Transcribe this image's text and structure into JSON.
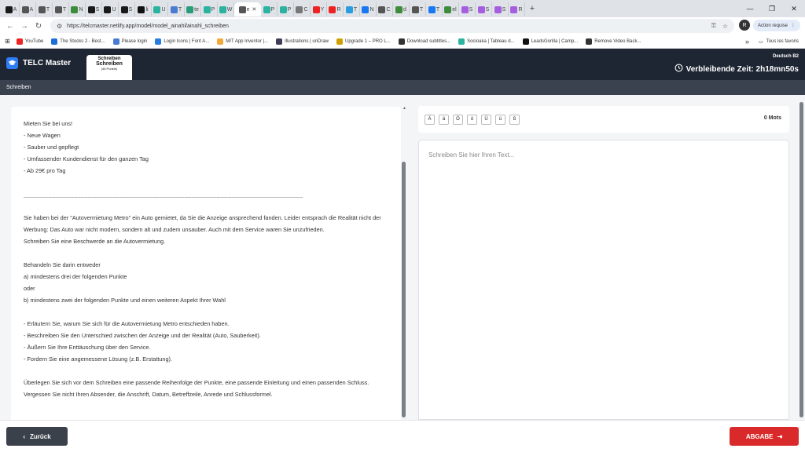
{
  "browser": {
    "tabs": [
      {
        "label": "A",
        "color": "#1a1a1a"
      },
      {
        "label": "A",
        "color": "#555"
      },
      {
        "label": "T",
        "color": "#555"
      },
      {
        "label": "T",
        "color": "#555"
      },
      {
        "label": "N",
        "color": "#3c8c3c"
      },
      {
        "label": "S",
        "color": "#1a1a1a"
      },
      {
        "label": "U",
        "color": "#1a1a1a"
      },
      {
        "label": "S",
        "color": "#1a1a1a"
      },
      {
        "label": "li",
        "color": "#111"
      },
      {
        "label": "U",
        "color": "#2bb3a0"
      },
      {
        "label": "T",
        "color": "#4a7bd0"
      },
      {
        "label": "te",
        "color": "#2b9c7a"
      },
      {
        "label": "P",
        "color": "#2bb3a0"
      },
      {
        "label": "W",
        "color": "#2bb3a0"
      }
    ],
    "active_tab": {
      "label": "e",
      "color": "#555"
    },
    "tabs_after": [
      {
        "label": "P",
        "color": "#2bb3a0"
      },
      {
        "label": "P",
        "color": "#2bb3a0"
      },
      {
        "label": "C",
        "color": "#777"
      },
      {
        "label": "Y",
        "color": "#e22"
      },
      {
        "label": "R",
        "color": "#e22"
      },
      {
        "label": "T",
        "color": "#2a9de0"
      },
      {
        "label": "N",
        "color": "#1877f2"
      },
      {
        "label": "C",
        "color": "#555"
      },
      {
        "label": "d",
        "color": "#3c8c3c"
      },
      {
        "label": "T",
        "color": "#555"
      },
      {
        "label": "T",
        "color": "#1877f2"
      },
      {
        "label": "el",
        "color": "#3c8c3c"
      },
      {
        "label": "S",
        "color": "#a55ee0"
      },
      {
        "label": "S",
        "color": "#a55ee0"
      },
      {
        "label": "S",
        "color": "#a55ee0"
      },
      {
        "label": "R",
        "color": "#a55ee0"
      }
    ],
    "new_tab_label": "+",
    "url": "https://telcmaster.netlify.app/model/model_ainahl/ainahl_schreiben",
    "profile_initial": "R",
    "action_label": "Action requise",
    "bookmarks": [
      {
        "label": "YouTube",
        "color": "#e22"
      },
      {
        "label": "The Stocks 2 - Best...",
        "color": "#1d6fd8"
      },
      {
        "label": "Please login",
        "color": "#4a7bd0"
      },
      {
        "label": "Login Icons | Font A...",
        "color": "#2a7de0"
      },
      {
        "label": "MIT App Inventor |...",
        "color": "#f2a93b"
      },
      {
        "label": "Illustrations | unDraw",
        "color": "#3f3d56"
      },
      {
        "label": "Upgrade 1 – PRO L...",
        "color": "#d1a000"
      },
      {
        "label": "Download subtitles...",
        "color": "#333"
      },
      {
        "label": "Socioaka | Tableau d...",
        "color": "#2bb3a0"
      },
      {
        "label": "LeadsGorilla | Camp...",
        "color": "#111"
      },
      {
        "label": "Remove Video Back...",
        "color": "#333"
      }
    ],
    "bookmarks_overflow": "»",
    "all_bookmarks": "Tous les favoris"
  },
  "header": {
    "brand": "TELC Master",
    "part_tab": {
      "line1": "Schreiben",
      "line2": "Schreiben",
      "line3": "(45 Punkte)"
    },
    "exam_level": "Deutsch B2",
    "timer_label": "Verbleibende Zeit: 2h18mn50s"
  },
  "section_title": "Schreiben",
  "task": {
    "ad_lines": [
      "Mieten Sie bei uns!",
      "- Neue Wagen",
      "- Sauber und gepflegt",
      "- Umfassender Kundendienst für den ganzen Tag",
      "- Ab 29€ pro Tag"
    ],
    "separator": "______________________________________________________________________________",
    "situation_lines": [
      "Sie haben bei der \"Autovermietung Metro\" ein Auto gemietet, da Sie die Anzeige ansprechend fanden. Leider entsprach die Realität nicht der Werbung: Das Auto war nicht modern, sondern alt und zudem unsauber. Auch mit dem Service waren Sie unzufrieden.",
      "Schreiben Sie eine Beschwerde an die Autovermietung."
    ],
    "instruction_lines": [
      "Behandeln Sie darin entweder",
      "a) mindestens drei der folgenden Punkte",
      "oder",
      "b) mindestens zwei der folgenden Punkte und einen weiteren Aspekt Ihrer Wahl"
    ],
    "points": [
      "- Erläutern Sie, warum Sie sich für die Autovermietung Metro entschieden haben.",
      "- Beschreiben Sie den Unterschied zwischen der Anzeige und der Realität (Auto, Sauberkeit).",
      "- Äußern Sie Ihre Enttäuschung über den Service.",
      "- Fordern Sie eine angemessene Lösung (z.B. Erstattung)."
    ],
    "closing": "Überlegen Sie sich vor dem Schreiben eine passende Reihenfolge der Punkte, eine passende Einleitung und einen passenden Schluss. Vergessen Sie nicht Ihren Absender, die Anschrift, Datum, Betreffzeile, Anrede und Schlussformel."
  },
  "editor": {
    "special_chars": [
      "Ä",
      "ä",
      "Ö",
      "ö",
      "Ü",
      "ü",
      "ß"
    ],
    "word_count": "0 Mots",
    "placeholder": "Schreiben Sie hier Ihren Text..."
  },
  "footer": {
    "back_label": "Zurück",
    "submit_label": "ABGABE"
  },
  "colors": {
    "header_bg": "#1e2633",
    "section_bg": "#3a4250",
    "brand_blue": "#2f7df6",
    "submit_red": "#d9292a",
    "back_gray": "#3b414b"
  }
}
